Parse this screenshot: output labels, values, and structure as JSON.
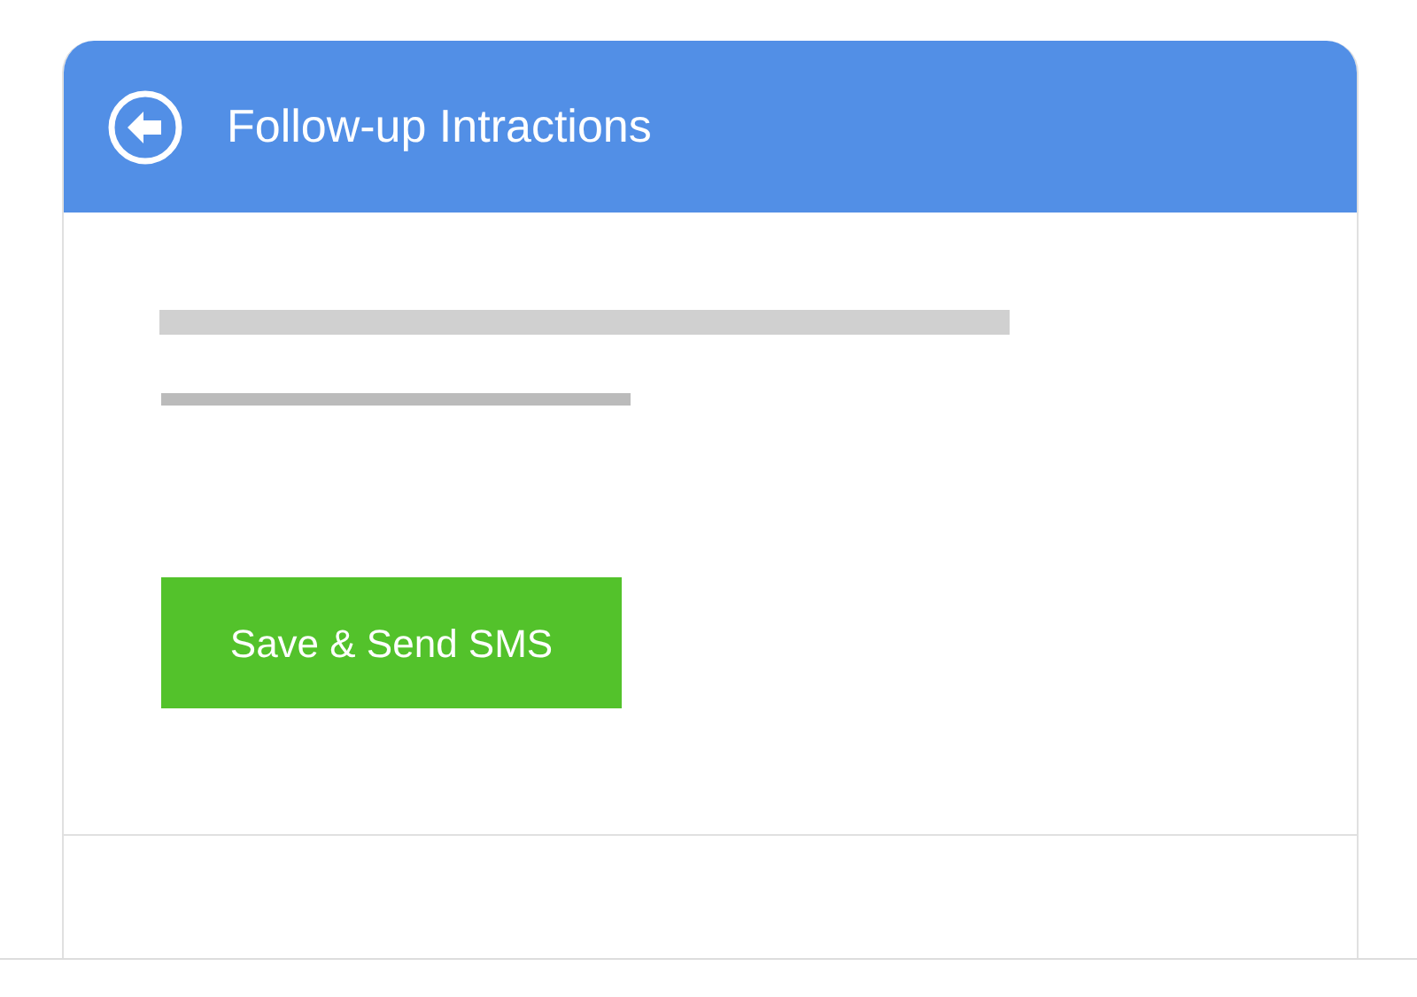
{
  "header": {
    "title": "Follow-up Intractions"
  },
  "actions": [
    {
      "label": "Save & Send SMS"
    }
  ]
}
